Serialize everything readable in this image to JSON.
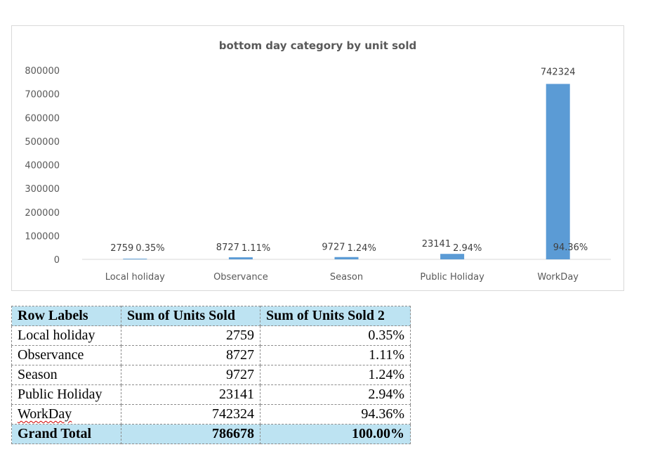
{
  "chart_data": {
    "type": "bar",
    "title": "bottom day category by unit sold",
    "categories": [
      "Local holiday",
      "Observance",
      "Season",
      "Public Holiday",
      "WorkDay"
    ],
    "values": [
      2759,
      8727,
      9727,
      23141,
      742324
    ],
    "percent_labels": [
      "0.35%",
      "1.11%",
      "1.24%",
      "2.94%",
      "94.36%"
    ],
    "ylim": [
      0,
      800000
    ],
    "yticks": [
      "0",
      "100000",
      "200000",
      "300000",
      "400000",
      "500000",
      "600000",
      "700000",
      "800000"
    ],
    "grid": false,
    "bar_color": "#5b9bd5"
  },
  "table": {
    "headers": [
      "Row Labels",
      "Sum of Units Sold",
      "Sum of Units Sold 2"
    ],
    "rows": [
      {
        "label": "Local holiday",
        "units": "2759",
        "pct": "0.35%"
      },
      {
        "label": "Observance",
        "units": "8727",
        "pct": "1.11%"
      },
      {
        "label": "Season",
        "units": "9727",
        "pct": "1.24%"
      },
      {
        "label": "Public Holiday",
        "units": "23141",
        "pct": "2.94%"
      },
      {
        "label": "WorkDay",
        "units": "742324",
        "pct": "94.36%"
      }
    ],
    "total": {
      "label": "Grand Total",
      "units": "786678",
      "pct": "100.00%"
    }
  }
}
